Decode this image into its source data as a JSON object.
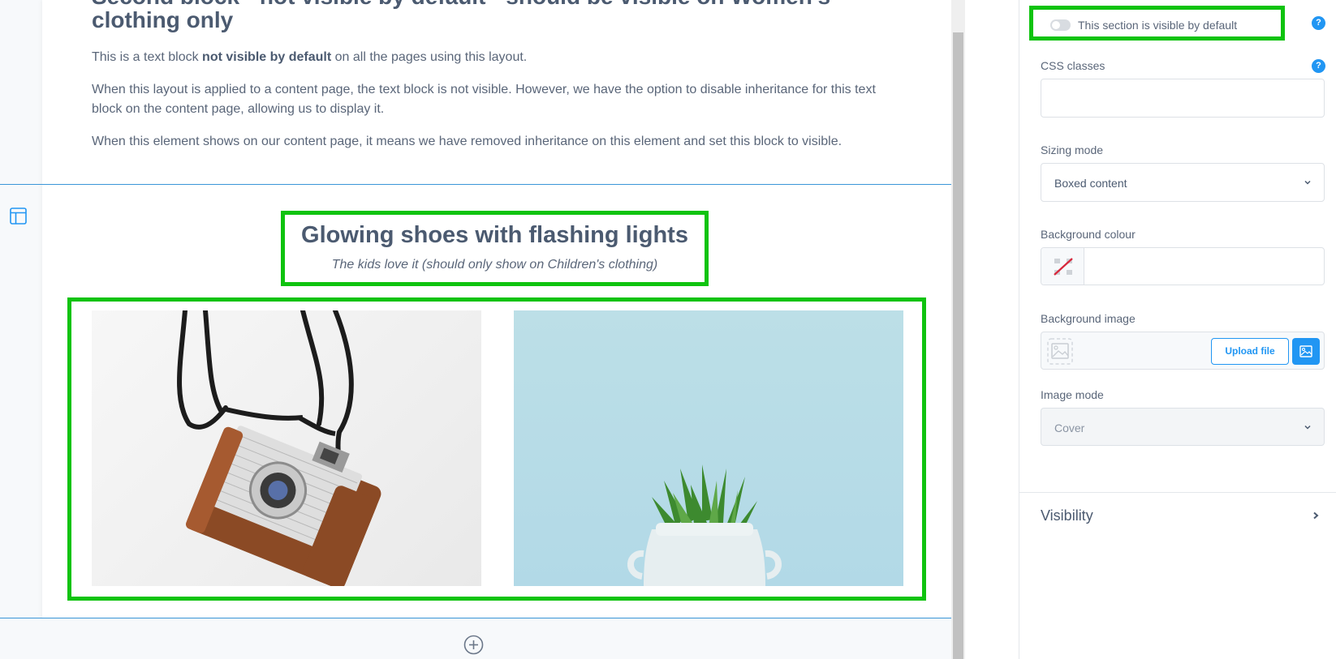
{
  "canvas": {
    "heading_line1": "Second block - not visible by default - should be visible on Women's",
    "heading_line2": "clothing only",
    "para1_before": "This is a text block ",
    "para1_bold": "not visible by default",
    "para1_after": " on all the pages using this layout.",
    "para2": "When this layout is applied to a content page, the text block is not visible. However, we have the option to disable inheritance for this text block on the content page, allowing us to display it.",
    "para3": "When this element shows on our content page, it means we have removed inheritance on this element and set this block to visible.",
    "section_title": "Glowing shoes with flashing lights",
    "section_subtitle": "The kids love it (should only show on Children's clothing)",
    "images": [
      {
        "alt": "Vintage camera with brown leather case and black strap"
      },
      {
        "alt": "Succulent plant in white ceramic jug on light blue background"
      }
    ],
    "layout_icon": "layout-icon",
    "add_icon": "plus-circle-icon"
  },
  "panel": {
    "visible_toggle": {
      "label": "This section is visible by default",
      "checked": false
    },
    "css_classes": {
      "label": "CSS classes",
      "value": ""
    },
    "sizing_mode": {
      "label": "Sizing mode",
      "value": "Boxed content"
    },
    "background_colour": {
      "label": "Background colour",
      "value": ""
    },
    "background_image": {
      "label": "Background image",
      "upload_label": "Upload file"
    },
    "image_mode": {
      "label": "Image mode",
      "value": "Cover"
    },
    "visibility": {
      "label": "Visibility"
    }
  },
  "colors": {
    "highlight_green": "#0fc30f",
    "accent_blue": "#2196f3",
    "divider_blue": "#3a96d8",
    "text": "#4b5a70"
  }
}
